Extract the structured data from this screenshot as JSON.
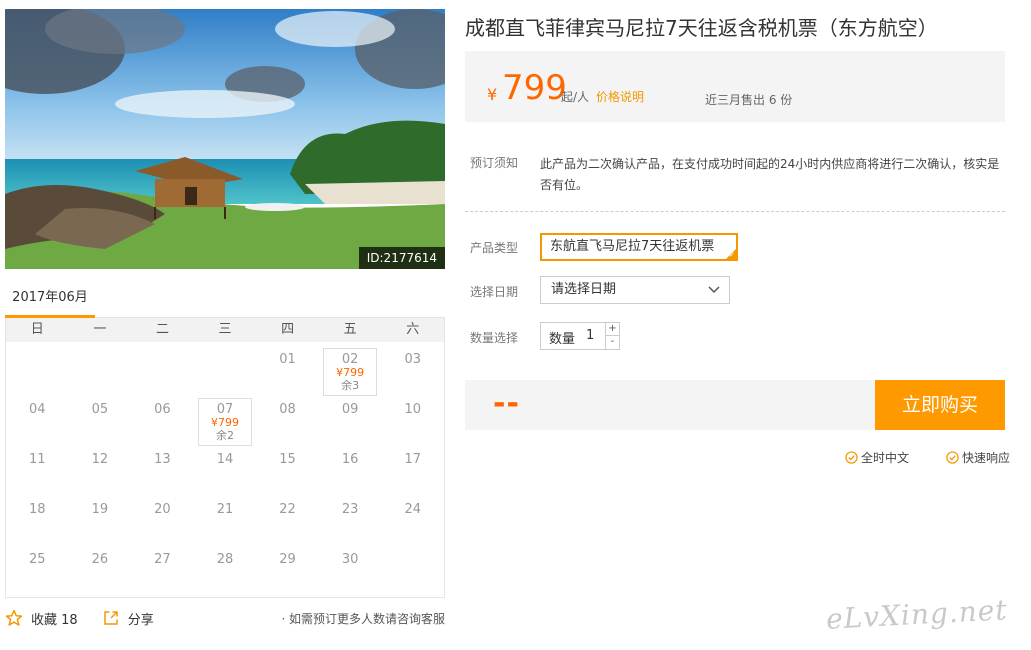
{
  "photo": {
    "id_label": "ID:2177614"
  },
  "calendar": {
    "month": "2017年06月",
    "weekdays": [
      "日",
      "一",
      "二",
      "三",
      "四",
      "五",
      "六"
    ],
    "leading_blanks": 4,
    "days": [
      {
        "d": "01"
      },
      {
        "d": "02",
        "price": "¥799",
        "left": "余3"
      },
      {
        "d": "03"
      },
      {
        "d": "04"
      },
      {
        "d": "05"
      },
      {
        "d": "06"
      },
      {
        "d": "07",
        "price": "¥799",
        "left": "余2"
      },
      {
        "d": "08"
      },
      {
        "d": "09"
      },
      {
        "d": "10"
      },
      {
        "d": "11"
      },
      {
        "d": "12"
      },
      {
        "d": "13"
      },
      {
        "d": "14"
      },
      {
        "d": "15"
      },
      {
        "d": "16"
      },
      {
        "d": "17"
      },
      {
        "d": "18"
      },
      {
        "d": "19"
      },
      {
        "d": "20"
      },
      {
        "d": "21"
      },
      {
        "d": "22"
      },
      {
        "d": "23"
      },
      {
        "d": "24"
      },
      {
        "d": "25"
      },
      {
        "d": "26"
      },
      {
        "d": "27"
      },
      {
        "d": "28"
      },
      {
        "d": "29"
      },
      {
        "d": "30"
      }
    ]
  },
  "share": {
    "favorite_label": "收藏 18",
    "share_label": "分享",
    "consult": "· 如需预订更多人数请咨询客服"
  },
  "product": {
    "title": "成都直飞菲律宾马尼拉7天往返含税机票（东方航空）",
    "currency": "¥",
    "price": "799",
    "price_unit": "起/人",
    "price_explain": "价格说明",
    "sold": "近三月售出 6 份"
  },
  "notice": {
    "label": "预订须知",
    "text": "此产品为二次确认产品，在支付成功时间起的24小时内供应商将进行二次确认，核实是否有位。"
  },
  "form": {
    "type_label": "产品类型",
    "type_value": "东航直飞马尼拉7天往返机票",
    "date_label": "选择日期",
    "date_placeholder": "请选择日期",
    "qty_label": "数量选择",
    "qty_inner_label": "数量",
    "qty_value": "1",
    "plus": "+",
    "minus": "-"
  },
  "buy": {
    "total": "--",
    "button": "立即购买"
  },
  "guarantees": [
    "全时中文",
    "快速响应"
  ],
  "watermark": "eLvXing.net",
  "colors": {
    "accent": "#ff9900",
    "price": "#ff6600"
  }
}
